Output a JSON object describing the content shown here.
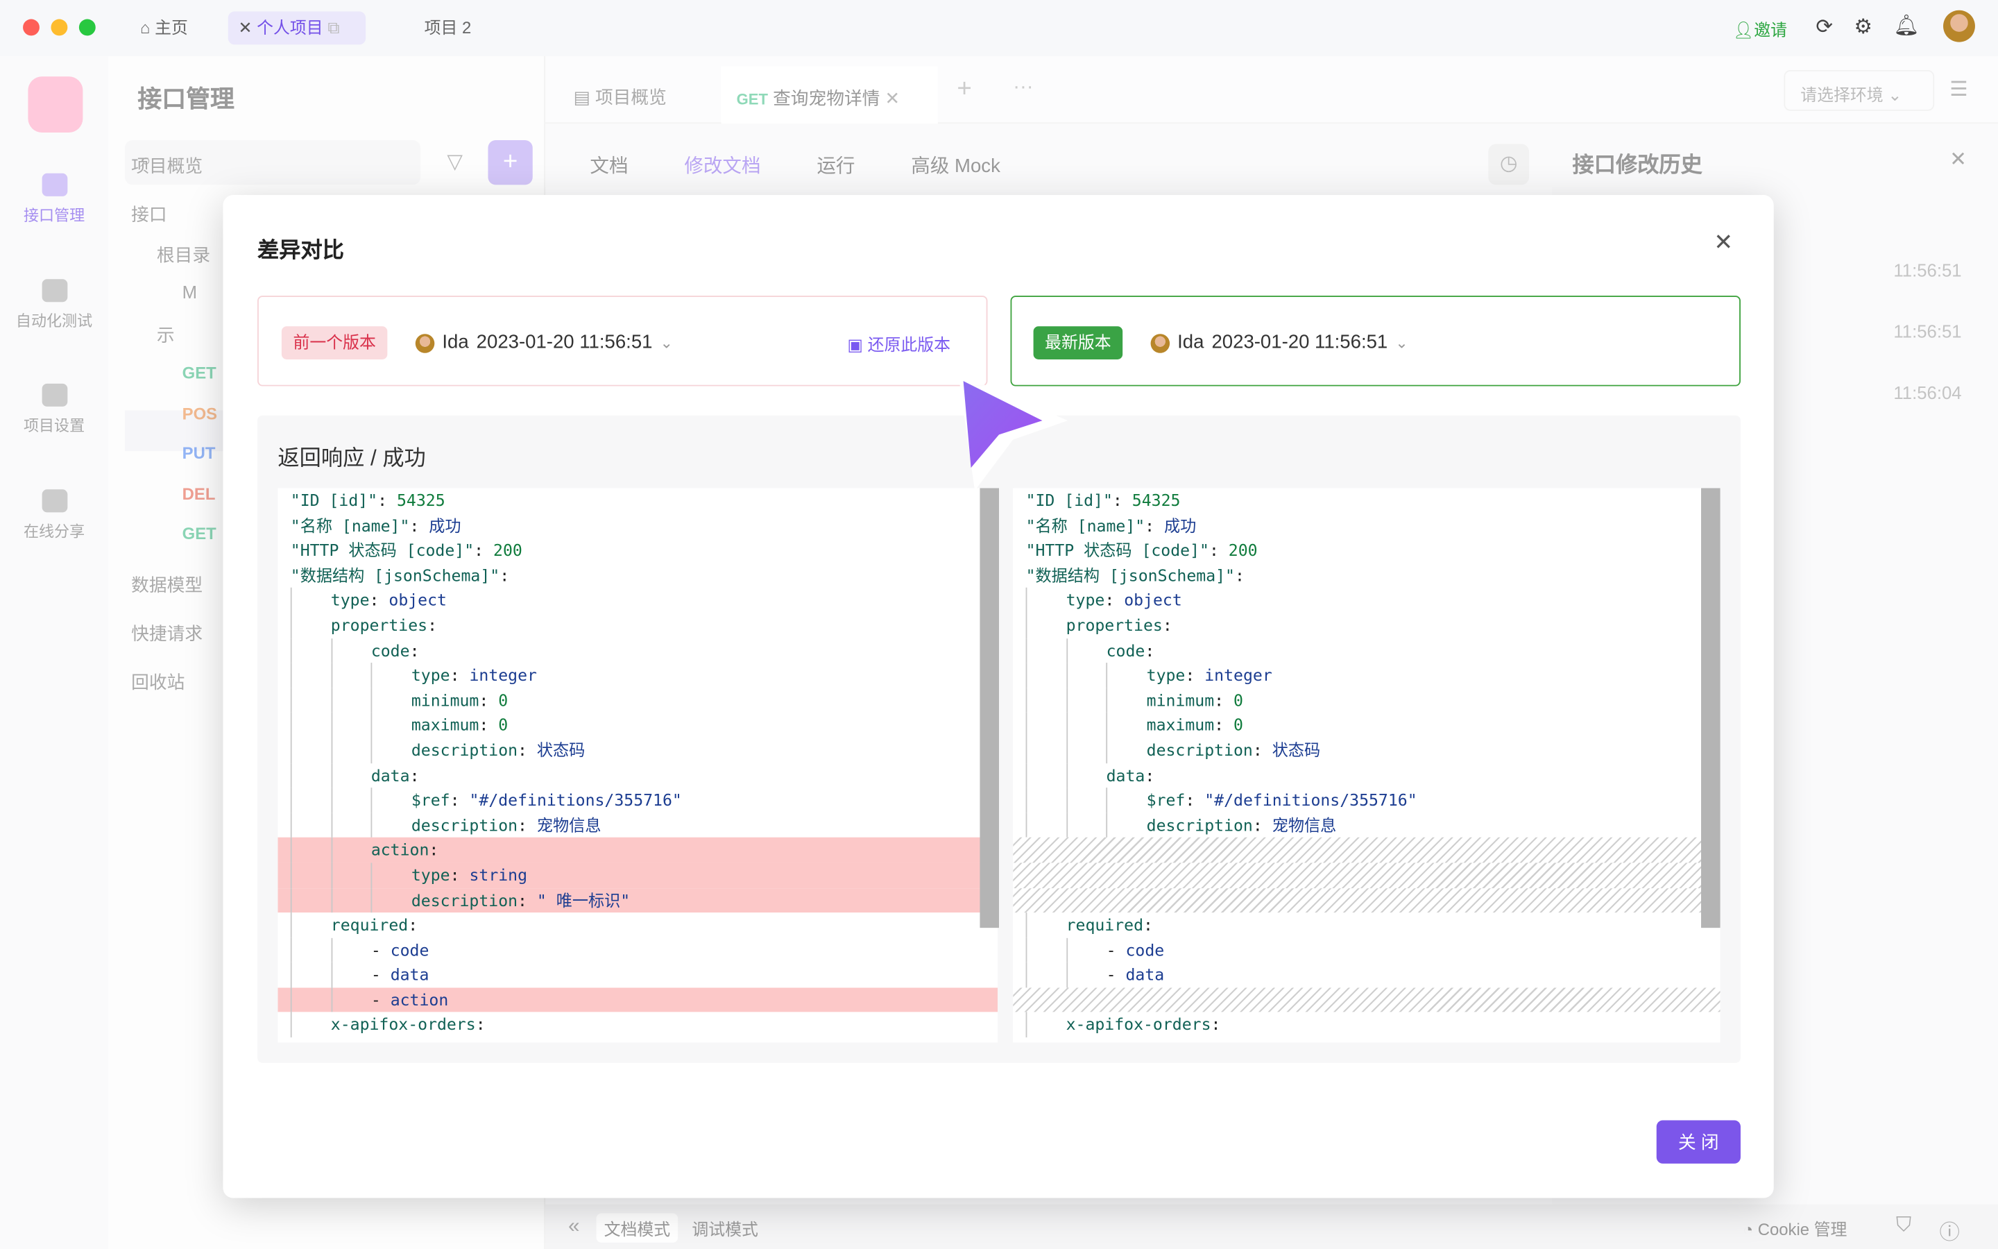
{
  "titlebar": {
    "home": "主页",
    "tabs": [
      "个人项目",
      "项目 2"
    ],
    "invite": "邀请"
  },
  "sidebar": {
    "items": [
      "接口管理",
      "自动化测试",
      "项目设置",
      "在线分享"
    ]
  },
  "panel": {
    "title": "接口管理",
    "tree": [
      {
        "label": "项目概览",
        "level": 0
      },
      {
        "label": "接口",
        "level": 0
      },
      {
        "label": "根目录",
        "level": 1
      },
      {
        "label": "M",
        "level": 2
      },
      {
        "label": "示",
        "level": 1
      },
      {
        "label": "GET",
        "level": 2,
        "color": "#2fb67c"
      },
      {
        "label": "POS",
        "level": 2,
        "color": "#f0883a"
      },
      {
        "label": "PUT",
        "level": 2,
        "color": "#3d7bf0"
      },
      {
        "label": "DEL",
        "level": 2,
        "color": "#e5533c"
      },
      {
        "label": "GET",
        "level": 2,
        "color": "#2fb67c"
      },
      {
        "label": "数据模型",
        "level": 0
      },
      {
        "label": "快捷请求",
        "level": 0
      },
      {
        "label": "回收站",
        "level": 0
      }
    ]
  },
  "main": {
    "tabs": [
      {
        "label": "项目概览"
      },
      {
        "method": "GET",
        "label": "查询宠物详情"
      }
    ],
    "env_placeholder": "请选择环境",
    "subtabs": [
      "文档",
      "修改文档",
      "运行",
      "高级 Mock"
    ],
    "history": {
      "title": "接口修改历史",
      "times": [
        "11:56:51",
        "11:56:51",
        "11:56:04"
      ]
    },
    "footer": {
      "modes": [
        "文档模式",
        "调试模式"
      ],
      "cookie": "Cookie 管理"
    }
  },
  "modal": {
    "title": "差异对比",
    "close_label": "关 闭",
    "left": {
      "tag": "前一个版本",
      "user": "Ida",
      "time": "2023-01-20 11:56:51",
      "restore": "还原此版本"
    },
    "right": {
      "tag": "最新版本",
      "user": "Ida",
      "time": "2023-01-20 11:56:51"
    },
    "section_title": "返回响应 / 成功",
    "lines": [
      {
        "i": 0,
        "k": "\"ID [id]\"",
        "v": "54325",
        "t": "n"
      },
      {
        "i": 0,
        "k": "\"名称 [name]\"",
        "v": "成功",
        "t": "v"
      },
      {
        "i": 0,
        "k": "\"HTTP 状态码 [code]\"",
        "v": "200",
        "t": "n"
      },
      {
        "i": 0,
        "k": "\"数据结构 [jsonSchema]\"",
        "v": ""
      },
      {
        "i": 1,
        "k": "type",
        "v": "object",
        "t": "v"
      },
      {
        "i": 1,
        "k": "properties",
        "v": ""
      },
      {
        "i": 2,
        "k": "code",
        "v": ""
      },
      {
        "i": 3,
        "k": "type",
        "v": "integer",
        "t": "v"
      },
      {
        "i": 3,
        "k": "minimum",
        "v": "0",
        "t": "n"
      },
      {
        "i": 3,
        "k": "maximum",
        "v": "0",
        "t": "n"
      },
      {
        "i": 3,
        "k": "description",
        "v": "状态码",
        "t": "v"
      },
      {
        "i": 2,
        "k": "data",
        "v": ""
      },
      {
        "i": 3,
        "k": "$ref",
        "v": "\"#/definitions/355716\"",
        "t": "v"
      },
      {
        "i": 3,
        "k": "description",
        "v": "宠物信息",
        "t": "v"
      },
      {
        "i": 2,
        "k": "action",
        "v": "",
        "removed": true
      },
      {
        "i": 3,
        "k": "type",
        "v": "string",
        "t": "v",
        "removed": true
      },
      {
        "i": 3,
        "k": "description",
        "v": "\" 唯一标识\"",
        "t": "v",
        "removed": true
      },
      {
        "i": 1,
        "k": "required",
        "v": ""
      },
      {
        "i": 2,
        "item": "code"
      },
      {
        "i": 2,
        "item": "data"
      },
      {
        "i": 2,
        "item": "action",
        "removed": true
      },
      {
        "i": 1,
        "k": "x-apifox-orders",
        "v": ""
      }
    ]
  },
  "colors": {
    "accent": "#7c56ea",
    "green": "#3aa345",
    "removed": "#fcc8c8"
  }
}
